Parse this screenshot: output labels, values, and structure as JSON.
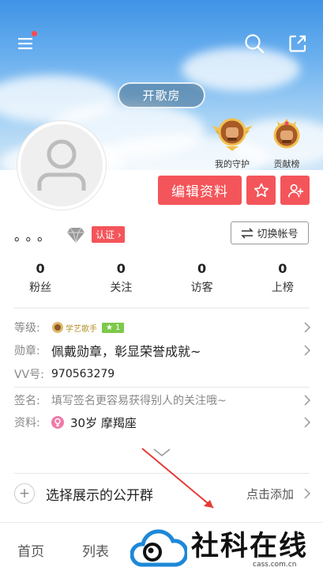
{
  "header": {
    "room_button": "开歌房",
    "badges": [
      {
        "label": "我的守护",
        "icon": "winged-guardian-badge-icon"
      },
      {
        "label": "贡献榜",
        "icon": "contribution-crown-badge-icon"
      }
    ],
    "icons": [
      "menu-icon",
      "search-icon",
      "share-icon"
    ]
  },
  "actions": {
    "edit_profile": "编辑资料",
    "favorite_icon": "star-icon",
    "follow_icon": "add-user-icon"
  },
  "profile": {
    "nickname": "。。。",
    "verify_tag": "认证 ›",
    "switch_account": "切换帐号"
  },
  "stats": [
    {
      "value": "0",
      "label": "粉丝"
    },
    {
      "value": "0",
      "label": "关注"
    },
    {
      "value": "0",
      "label": "访客"
    },
    {
      "value": "0",
      "label": "上榜"
    }
  ],
  "info": {
    "level_label": "等级:",
    "level_title": "学艺歌手",
    "level_num": "1",
    "medal_label": "勋章:",
    "medal_value": "佩戴勋章，彰显荣誉成就~",
    "vv_label": "VV号:",
    "vv_value": "970563279",
    "sign_label": "签名:",
    "sign_value": "填写签名更容易获得别人的关注哦~",
    "data_label": "资料:",
    "data_value": "30岁 摩羯座"
  },
  "group": {
    "title": "选择展示的公开群",
    "action": "点击添加"
  },
  "tabs": [
    "首页",
    "列表"
  ],
  "watermark": {
    "text": "社科在线",
    "url": "cass.com.cn"
  },
  "colors": {
    "accent": "#f4555a",
    "level_green": "#7dc94a",
    "sky_top": "#3f93e6"
  }
}
